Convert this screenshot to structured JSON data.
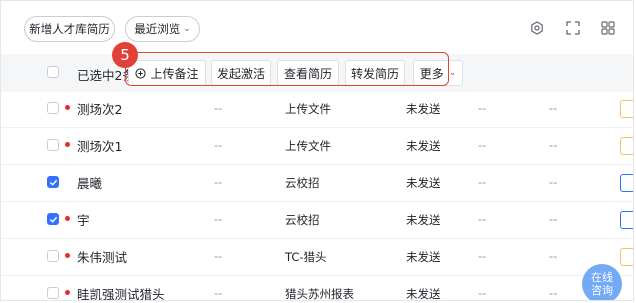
{
  "toolbar": {
    "add_talent_resume": "新增人才库简历",
    "recent_browse": "最近浏览",
    "icons": [
      "settings-icon",
      "fullscreen-icon",
      "grid-view-icon"
    ]
  },
  "table_header": {
    "selected_label": "已选中2条",
    "step_badge": "5",
    "actions": [
      "上传备注",
      "发起激活",
      "查看简历",
      "转发简历",
      "更多"
    ]
  },
  "rows": [
    {
      "name": "测场次2",
      "checked": false,
      "col1": "--",
      "source": "上传文件",
      "status": "未发送",
      "col4": "--",
      "col5": "--"
    },
    {
      "name": "测场次1",
      "checked": false,
      "col1": "--",
      "source": "上传文件",
      "status": "未发送",
      "col4": "--",
      "col5": "--"
    },
    {
      "name": "晨曦",
      "checked": true,
      "col1": "--",
      "source": "云校招",
      "status": "未发送",
      "col4": "--",
      "col5": "--"
    },
    {
      "name": "宇",
      "checked": true,
      "col1": "--",
      "source": "云校招",
      "status": "未发送",
      "col4": "--",
      "col5": "--"
    },
    {
      "name": "朱伟测试",
      "checked": false,
      "col1": "--",
      "source": "TC-猎头",
      "status": "未发送",
      "col4": "--",
      "col5": "--"
    },
    {
      "name": "眭凯强测试猎头",
      "checked": false,
      "col1": "--",
      "source": "猎头苏州报表",
      "status": "未发送",
      "col4": "--",
      "col5": "--"
    }
  ],
  "chat": {
    "line1": "在线",
    "line2": "咨询"
  },
  "colors": {
    "accent_blue": "#3370ff",
    "highlight_red": "#e0423a",
    "dot_red": "#e0302a"
  }
}
